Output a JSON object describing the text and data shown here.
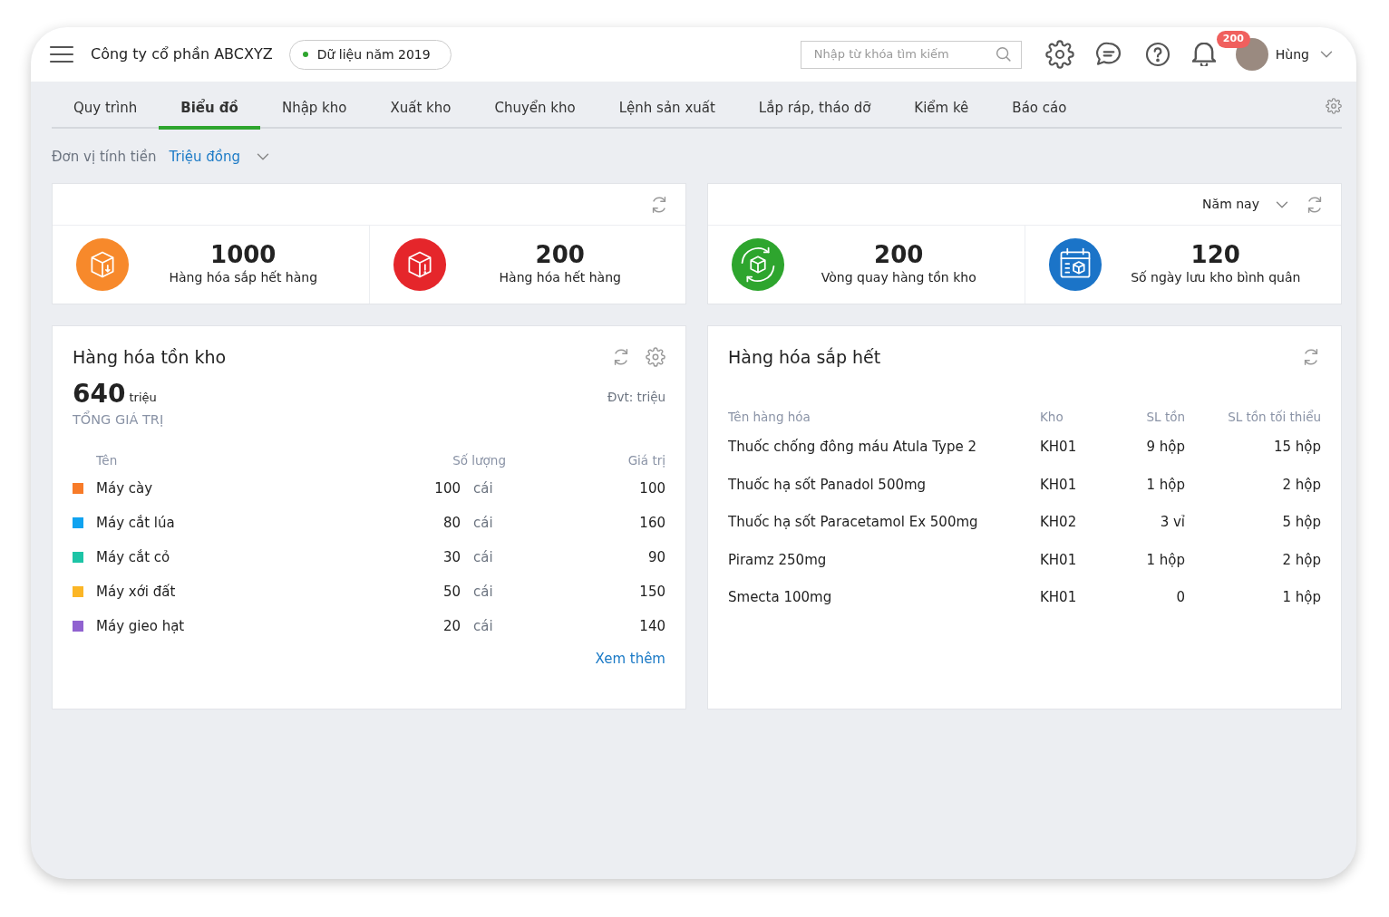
{
  "header": {
    "company": "Công ty cổ phần ABCXYZ",
    "data_badge": "Dữ liệu năm 2019",
    "search": {
      "placeholder": "Nhập từ khóa tìm kiếm"
    },
    "notification_count": "200",
    "user": "Hùng"
  },
  "tabs": [
    {
      "label": "Quy trình",
      "selected": false
    },
    {
      "label": "Biểu đồ",
      "selected": true
    },
    {
      "label": "Nhập kho",
      "selected": false
    },
    {
      "label": "Xuất kho",
      "selected": false
    },
    {
      "label": "Chuyển kho",
      "selected": false
    },
    {
      "label": "Lệnh sản xuất",
      "selected": false
    },
    {
      "label": "Lắp ráp, tháo dỡ",
      "selected": false
    },
    {
      "label": "Kiểm kê",
      "selected": false
    },
    {
      "label": "Báo cáo",
      "selected": false
    }
  ],
  "unit": {
    "label": "Đơn vị tính tiền",
    "value": "Triệu đồng"
  },
  "stat_groups": [
    {
      "stats": [
        {
          "kind": "box-down",
          "color": "#f7892b",
          "value": "1000",
          "label": "Hàng hóa sắp hết hàng"
        },
        {
          "kind": "box-alert",
          "color": "#e5262b",
          "value": "200",
          "label": "Hàng hóa hết hàng"
        }
      ]
    },
    {
      "filter": "Năm nay",
      "stats": [
        {
          "kind": "box-cycle",
          "color": "#2ea52e",
          "value": "200",
          "label": "Vòng quay hàng tồn kho"
        },
        {
          "kind": "calendar-box",
          "color": "#1b74c8",
          "value": "120",
          "label": "Số ngày lưu kho bình quân"
        }
      ]
    }
  ],
  "inventory": {
    "title": "Hàng hóa tồn kho",
    "total": "640",
    "total_unit": "triệu",
    "total_label": "TỔNG GIÁ TRỊ",
    "unit_note": "Đvt: triệu",
    "columns": [
      "Tên",
      "Số lượng",
      "Giá trị"
    ],
    "rows": [
      {
        "name": "Máy cày",
        "color": "#f77b29",
        "quantity": "100",
        "unit": "cái",
        "value": "100"
      },
      {
        "name": "Máy cắt lúa",
        "color": "#10a3f0",
        "quantity": "80",
        "unit": "cái",
        "value": "160"
      },
      {
        "name": "Máy cắt cỏ",
        "color": "#1dc4a6",
        "quantity": "30",
        "unit": "cái",
        "value": "90"
      },
      {
        "name": "Máy xới đất",
        "color": "#fbb626",
        "quantity": "50",
        "unit": "cái",
        "value": "150"
      },
      {
        "name": "Máy gieo hạt",
        "color": "#9062d0",
        "quantity": "20",
        "unit": "cái",
        "value": "140"
      }
    ],
    "more_link": "Xem thêm"
  },
  "low_stock": {
    "title": "Hàng hóa sắp hết",
    "columns": [
      "Tên hàng hóa",
      "Kho",
      "SL tồn",
      "SL tồn tối thiểu"
    ],
    "rows": [
      [
        "Thuốc chống đông máu Atula Type 2",
        "KH01",
        "9 hộp",
        "15 hộp"
      ],
      [
        "Thuốc hạ sốt Panadol 500mg",
        "KH01",
        "1 hộp",
        "2 hộp"
      ],
      [
        "Thuốc hạ sốt Paracetamol Ex 500mg",
        "KH02",
        "3 vỉ",
        "5 hộp"
      ],
      [
        "Piramz 250mg",
        "KH01",
        "1 hộp",
        "2 hộp"
      ],
      [
        "Smecta 100mg",
        "KH01",
        "0",
        "1 hộp"
      ]
    ]
  }
}
